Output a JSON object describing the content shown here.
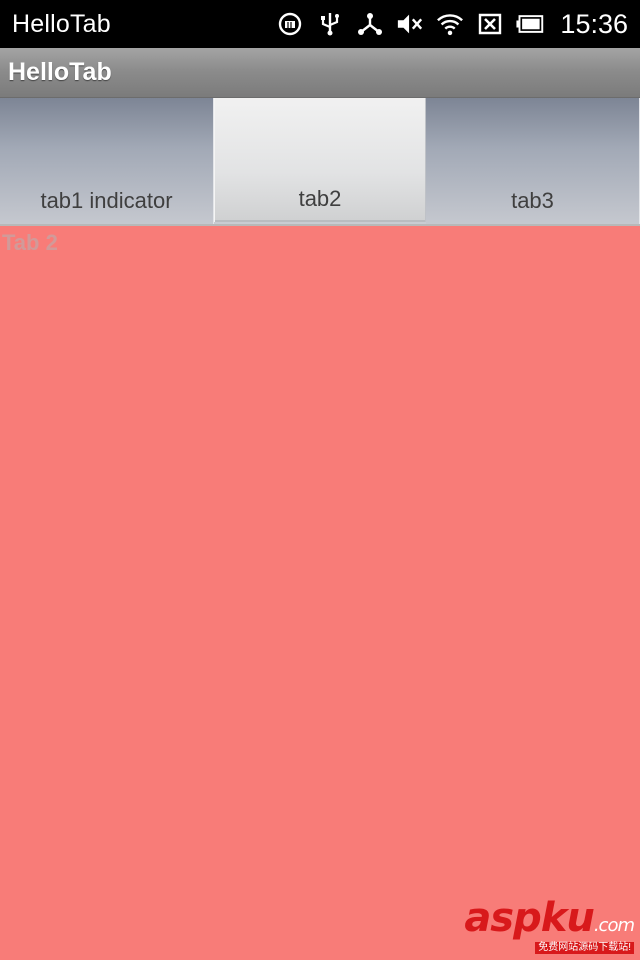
{
  "status_bar": {
    "app_title": "HelloTab",
    "time": "15:36",
    "icons": [
      "mm-icon",
      "usb-icon",
      "tether-icon",
      "mute-icon",
      "wifi-icon",
      "no-sim-icon",
      "battery-icon"
    ]
  },
  "action_bar": {
    "title": "HelloTab"
  },
  "tabs": [
    {
      "label": "tab1 indicator",
      "selected": false
    },
    {
      "label": "tab2",
      "selected": true
    },
    {
      "label": "tab3",
      "selected": false
    }
  ],
  "content": {
    "text": "Tab 2",
    "background": "#f87c78"
  },
  "watermark": {
    "brand": "aspku",
    "domain": ".com",
    "tagline": "免费网站源码下载站!"
  }
}
